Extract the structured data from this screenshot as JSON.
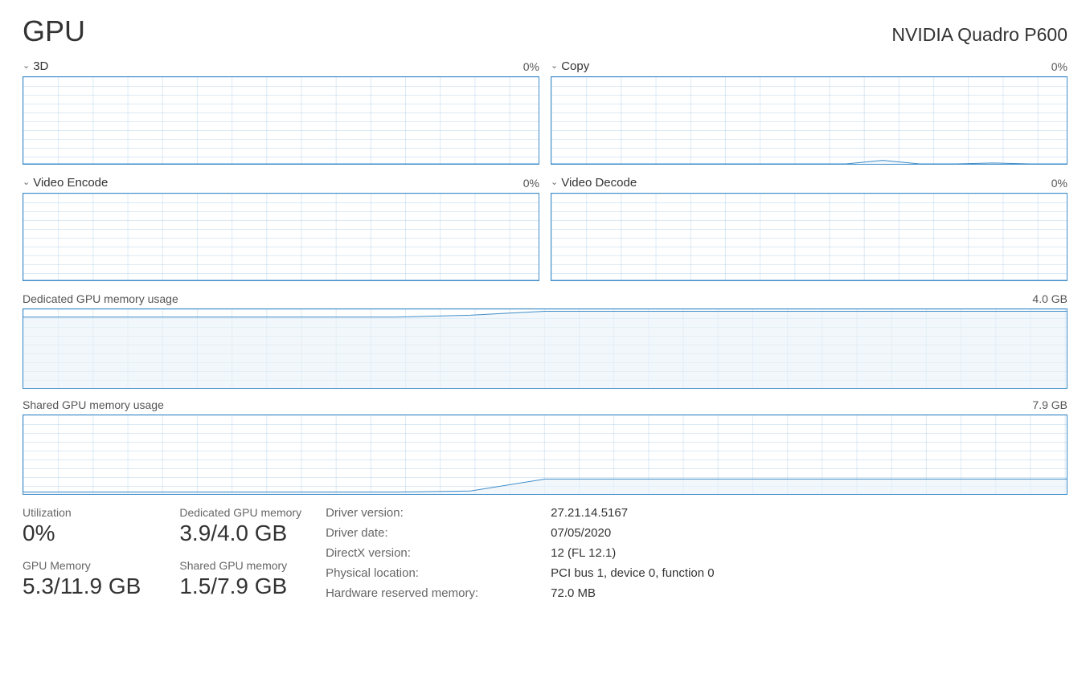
{
  "title": "GPU",
  "gpu_name": "NVIDIA Quadro P600",
  "engines": [
    {
      "label": "3D",
      "percent": "0%"
    },
    {
      "label": "Copy",
      "percent": "0%"
    },
    {
      "label": "Video Encode",
      "percent": "0%"
    },
    {
      "label": "Video Decode",
      "percent": "0%"
    }
  ],
  "mem_sections": [
    {
      "label": "Dedicated GPU memory usage",
      "max": "4.0 GB"
    },
    {
      "label": "Shared GPU memory usage",
      "max": "7.9 GB"
    }
  ],
  "stats": {
    "utilization": {
      "label": "Utilization",
      "value": "0%"
    },
    "dedicated": {
      "label": "Dedicated GPU memory",
      "value": "3.9/4.0 GB"
    },
    "gpu_memory": {
      "label": "GPU Memory",
      "value": "5.3/11.9 GB"
    },
    "shared": {
      "label": "Shared GPU memory",
      "value": "1.5/7.9 GB"
    }
  },
  "props": [
    {
      "label": "Driver version:",
      "value": "27.21.14.5167"
    },
    {
      "label": "Driver date:",
      "value": "07/05/2020"
    },
    {
      "label": "DirectX version:",
      "value": "12 (FL 12.1)"
    },
    {
      "label": "Physical location:",
      "value": "PCI bus 1, device 0, function 0"
    },
    {
      "label": "Hardware reserved memory:",
      "value": "72.0 MB"
    }
  ],
  "chart_data": [
    {
      "type": "line",
      "title": "3D",
      "ylim": [
        0,
        100
      ],
      "x": [
        0,
        1,
        2,
        3,
        4,
        5,
        6,
        7,
        8,
        9,
        10,
        11,
        12,
        13,
        14
      ],
      "values": [
        0,
        0,
        0,
        0,
        0,
        0,
        0,
        0,
        0,
        0,
        0,
        0,
        0,
        0,
        0
      ]
    },
    {
      "type": "line",
      "title": "Copy",
      "ylim": [
        0,
        100
      ],
      "x": [
        0,
        1,
        2,
        3,
        4,
        5,
        6,
        7,
        8,
        9,
        10,
        11,
        12,
        13,
        14
      ],
      "values": [
        0,
        0,
        0,
        0,
        0,
        0,
        0,
        0,
        0,
        4,
        0,
        0,
        1,
        0,
        0
      ]
    },
    {
      "type": "line",
      "title": "Video Encode",
      "ylim": [
        0,
        100
      ],
      "x": [
        0,
        1,
        2,
        3,
        4,
        5,
        6,
        7,
        8,
        9,
        10,
        11,
        12,
        13,
        14
      ],
      "values": [
        0,
        0,
        0,
        0,
        0,
        0,
        0,
        0,
        0,
        0,
        0,
        0,
        0,
        0,
        0
      ]
    },
    {
      "type": "line",
      "title": "Video Decode",
      "ylim": [
        0,
        100
      ],
      "x": [
        0,
        1,
        2,
        3,
        4,
        5,
        6,
        7,
        8,
        9,
        10,
        11,
        12,
        13,
        14
      ],
      "values": [
        0,
        0,
        0,
        0,
        0,
        0,
        0,
        0,
        0,
        0,
        0,
        0,
        0,
        0,
        0
      ]
    },
    {
      "type": "area",
      "title": "Dedicated GPU memory usage",
      "ylim": [
        0,
        4.0
      ],
      "ylabel": "GB",
      "x": [
        0,
        1,
        2,
        3,
        4,
        5,
        6,
        7,
        8,
        9,
        10,
        11,
        12,
        13,
        14
      ],
      "values": [
        3.6,
        3.6,
        3.6,
        3.6,
        3.6,
        3.6,
        3.7,
        3.9,
        3.9,
        3.9,
        3.9,
        3.9,
        3.9,
        3.9,
        3.9
      ]
    },
    {
      "type": "area",
      "title": "Shared GPU memory usage",
      "ylim": [
        0,
        7.9
      ],
      "ylabel": "GB",
      "x": [
        0,
        1,
        2,
        3,
        4,
        5,
        6,
        7,
        8,
        9,
        10,
        11,
        12,
        13,
        14
      ],
      "values": [
        0.2,
        0.2,
        0.2,
        0.2,
        0.2,
        0.2,
        0.3,
        1.5,
        1.5,
        1.5,
        1.5,
        1.5,
        1.5,
        1.5,
        1.5
      ]
    }
  ]
}
